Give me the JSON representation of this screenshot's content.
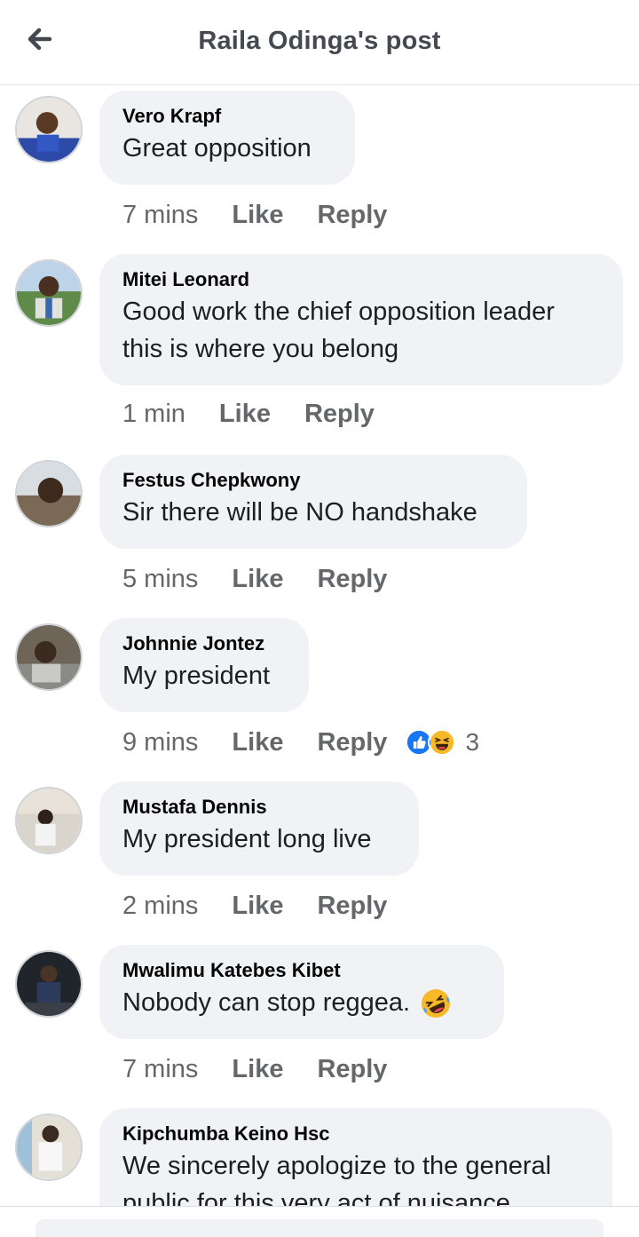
{
  "header": {
    "title": "Raila Odinga's post",
    "back_icon": "arrow-left-icon"
  },
  "actions": {
    "like": "Like",
    "reply": "Reply"
  },
  "comments": [
    {
      "author": "Vero Krapf",
      "text": "Great opposition",
      "time": "7 mins"
    },
    {
      "author": "Mitei Leonard",
      "text": "Good work the chief opposition leader this is where you belong",
      "time": "1 min"
    },
    {
      "author": "Festus Chepkwony",
      "text": "Sir there will be NO handshake",
      "time": "5 mins"
    },
    {
      "author": "Johnnie Jontez",
      "text": "My president",
      "time": "9 mins",
      "reaction_count": "3",
      "reaction_icons": [
        "like-reaction-icon",
        "haha-reaction-icon"
      ]
    },
    {
      "author": "Mustafa Dennis",
      "text": "My president long live",
      "time": "2 mins"
    },
    {
      "author": "Mwalimu Katebes Kibet",
      "text": "Nobody can stop reggea.",
      "time": "7 mins",
      "emoji": "rolling-laughing-emoji"
    },
    {
      "author": "Kipchumba Keino Hsc",
      "text": "We sincerely apologize to the general public for this very act of nuisance"
    }
  ],
  "colors": {
    "bubble": "#f0f2f5",
    "meta_text": "#65676b",
    "like_blue": "#1877f2",
    "haha_yellow": "#f7b928"
  }
}
